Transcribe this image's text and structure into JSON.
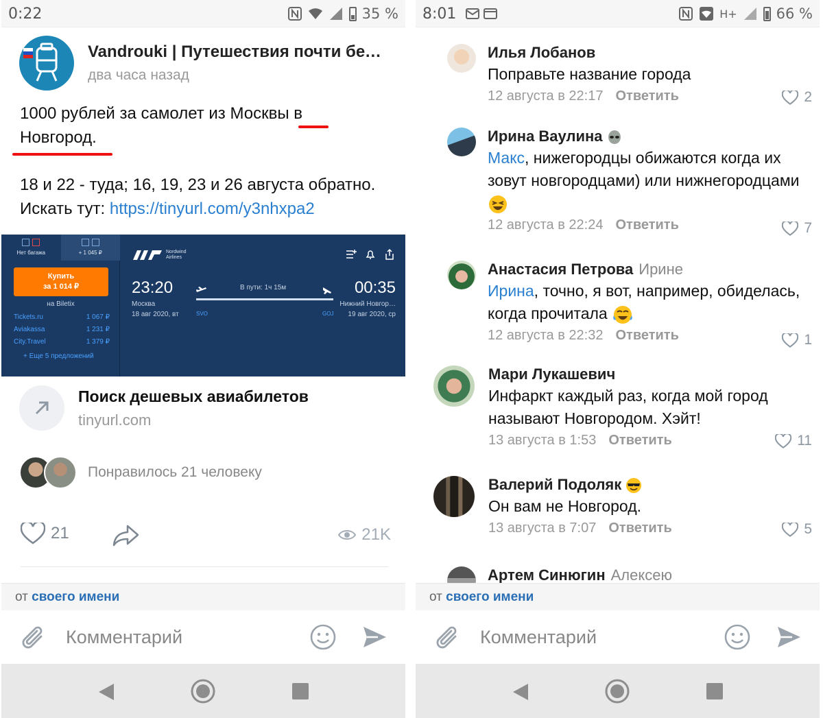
{
  "left": {
    "status": {
      "time": "0:22",
      "battery": "35 %",
      "battery_level": 0.35
    },
    "post": {
      "author": "Vandrouki | Путешествия почти бес…",
      "time": "два часа назад",
      "line1a": "1000 рублей за самолет из Москвы ",
      "line1b": "в",
      "line2": "Новгород.",
      "dates": "18 и 22 - туда; 16, 19, 23 и 26 августа обратно.",
      "search_prefix": "Искать тут: ",
      "search_link": "https://tinyurl.com/y3nhxpa2"
    },
    "flight": {
      "tab_no_baggage": "Нет багажа",
      "tab_price": "+ 1 045 ₽",
      "buy_line1": "Купить",
      "buy_line2": "за 1 014 ₽",
      "on_biletix": "на Biletix",
      "agencies": [
        {
          "name": "Tickets.ru",
          "price": "1 067 ₽"
        },
        {
          "name": "Aviakassa",
          "price": "1 231 ₽"
        },
        {
          "name": "City.Travel",
          "price": "1 379 ₽"
        }
      ],
      "more_offers": "+ Еще 5 предложений",
      "airline_name": "Nordwind",
      "airline_sub": "Airlines",
      "dep_time": "23:20",
      "arr_time": "00:35",
      "dep_city": "Москва",
      "dep_date": "18 авг 2020, вт",
      "arr_city": "Нижний Новгор…",
      "arr_date": "19 авг 2020, ср",
      "in_way": "В пути: 1ч 15м",
      "dep_code": "SVO",
      "arr_code": "GOJ"
    },
    "link_preview": {
      "title": "Поиск дешевых авиабилетов",
      "domain": "tinyurl.com"
    },
    "liked_text": "Понравилось 21 человеку",
    "like_count": "21",
    "views": "21K"
  },
  "right": {
    "status": {
      "time": "8:01",
      "network": "H+",
      "battery": "66 %",
      "battery_level": 0.66
    },
    "comments": [
      {
        "name": "Илья Лобанов",
        "to": "",
        "text": "Поправьте название города",
        "date": "12 августа в 22:17",
        "likes": "2"
      },
      {
        "name": "Ирина Ваулина",
        "to": "",
        "mention": "Макс",
        "text": ", нижегородцы обижаются когда их зовут новгородцами) или нижнегородцами",
        "date": "12 августа в 22:24",
        "likes": "7"
      },
      {
        "name": "Анастасия Петрова",
        "to": "Ирине",
        "mention": "Ирина",
        "text": ", точно, я вот, например, обиделась, когда прочитала",
        "date": "12 августа в 22:32",
        "likes": "1"
      },
      {
        "name": "Мари Лукашевич",
        "to": "",
        "text": "Инфаркт  каждый раз, когда мой город называют Новгородом. Хэйт!",
        "date": "13 августа в 1:53",
        "likes": "11"
      },
      {
        "name": "Валерий Подоляк",
        "to": "",
        "text": "Он вам не Новгород.",
        "date": "13 августа в 7:07",
        "likes": "5"
      },
      {
        "name": "Артем Синюгин",
        "to": "Алексею"
      }
    ]
  },
  "shared": {
    "from_prefix": "от ",
    "from_name": "своего имени",
    "comment_placeholder": "Комментарий",
    "reply_label": "Ответить"
  },
  "icons": {
    "attach": "paperclip-icon",
    "smile": "smile-icon",
    "send": "send-icon",
    "back": "back-triangle-icon",
    "home": "home-circle-icon",
    "recent": "recent-square-icon",
    "like": "heart-icon",
    "share": "share-arrow-icon",
    "views": "eye-icon"
  },
  "colors": {
    "link": "#2a7fd0",
    "underline": "#e11",
    "flight_bg": "#1a3a63",
    "buy": "#ff7a00"
  }
}
